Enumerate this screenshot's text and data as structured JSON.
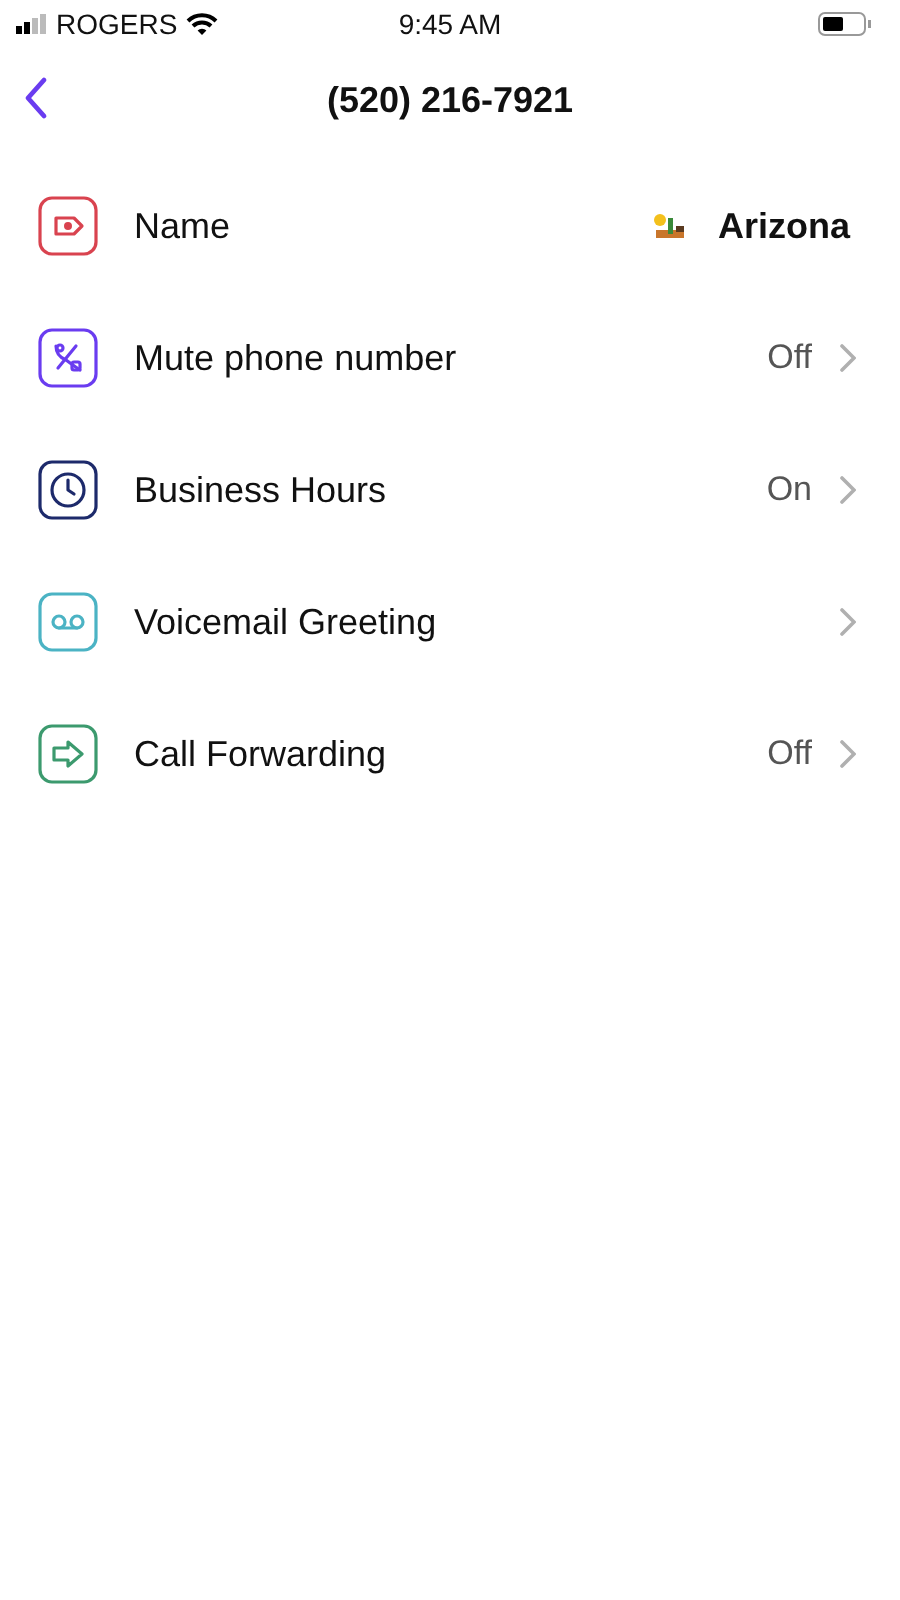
{
  "status_bar": {
    "carrier": "ROGERS",
    "time": "9:45 AM"
  },
  "nav": {
    "title": "(520) 216-7921"
  },
  "items": [
    {
      "kind": "tag",
      "color": "#d9434f",
      "label": "Name",
      "value": "Arizona",
      "flag": true,
      "chevron": false
    },
    {
      "kind": "mute",
      "color": "#6a3cf0",
      "label": "Mute phone number",
      "value": "Off",
      "flag": false,
      "chevron": true
    },
    {
      "kind": "clock",
      "color": "#1d2a6b",
      "label": "Business Hours",
      "value": "On",
      "flag": false,
      "chevron": true
    },
    {
      "kind": "voicemail",
      "color": "#4bb3c4",
      "label": "Voicemail Greeting",
      "flag": false,
      "chevron": true
    },
    {
      "kind": "forward",
      "color": "#3c9a6e",
      "label": "Call Forwarding",
      "value": "Off",
      "flag": false,
      "chevron": true
    }
  ]
}
